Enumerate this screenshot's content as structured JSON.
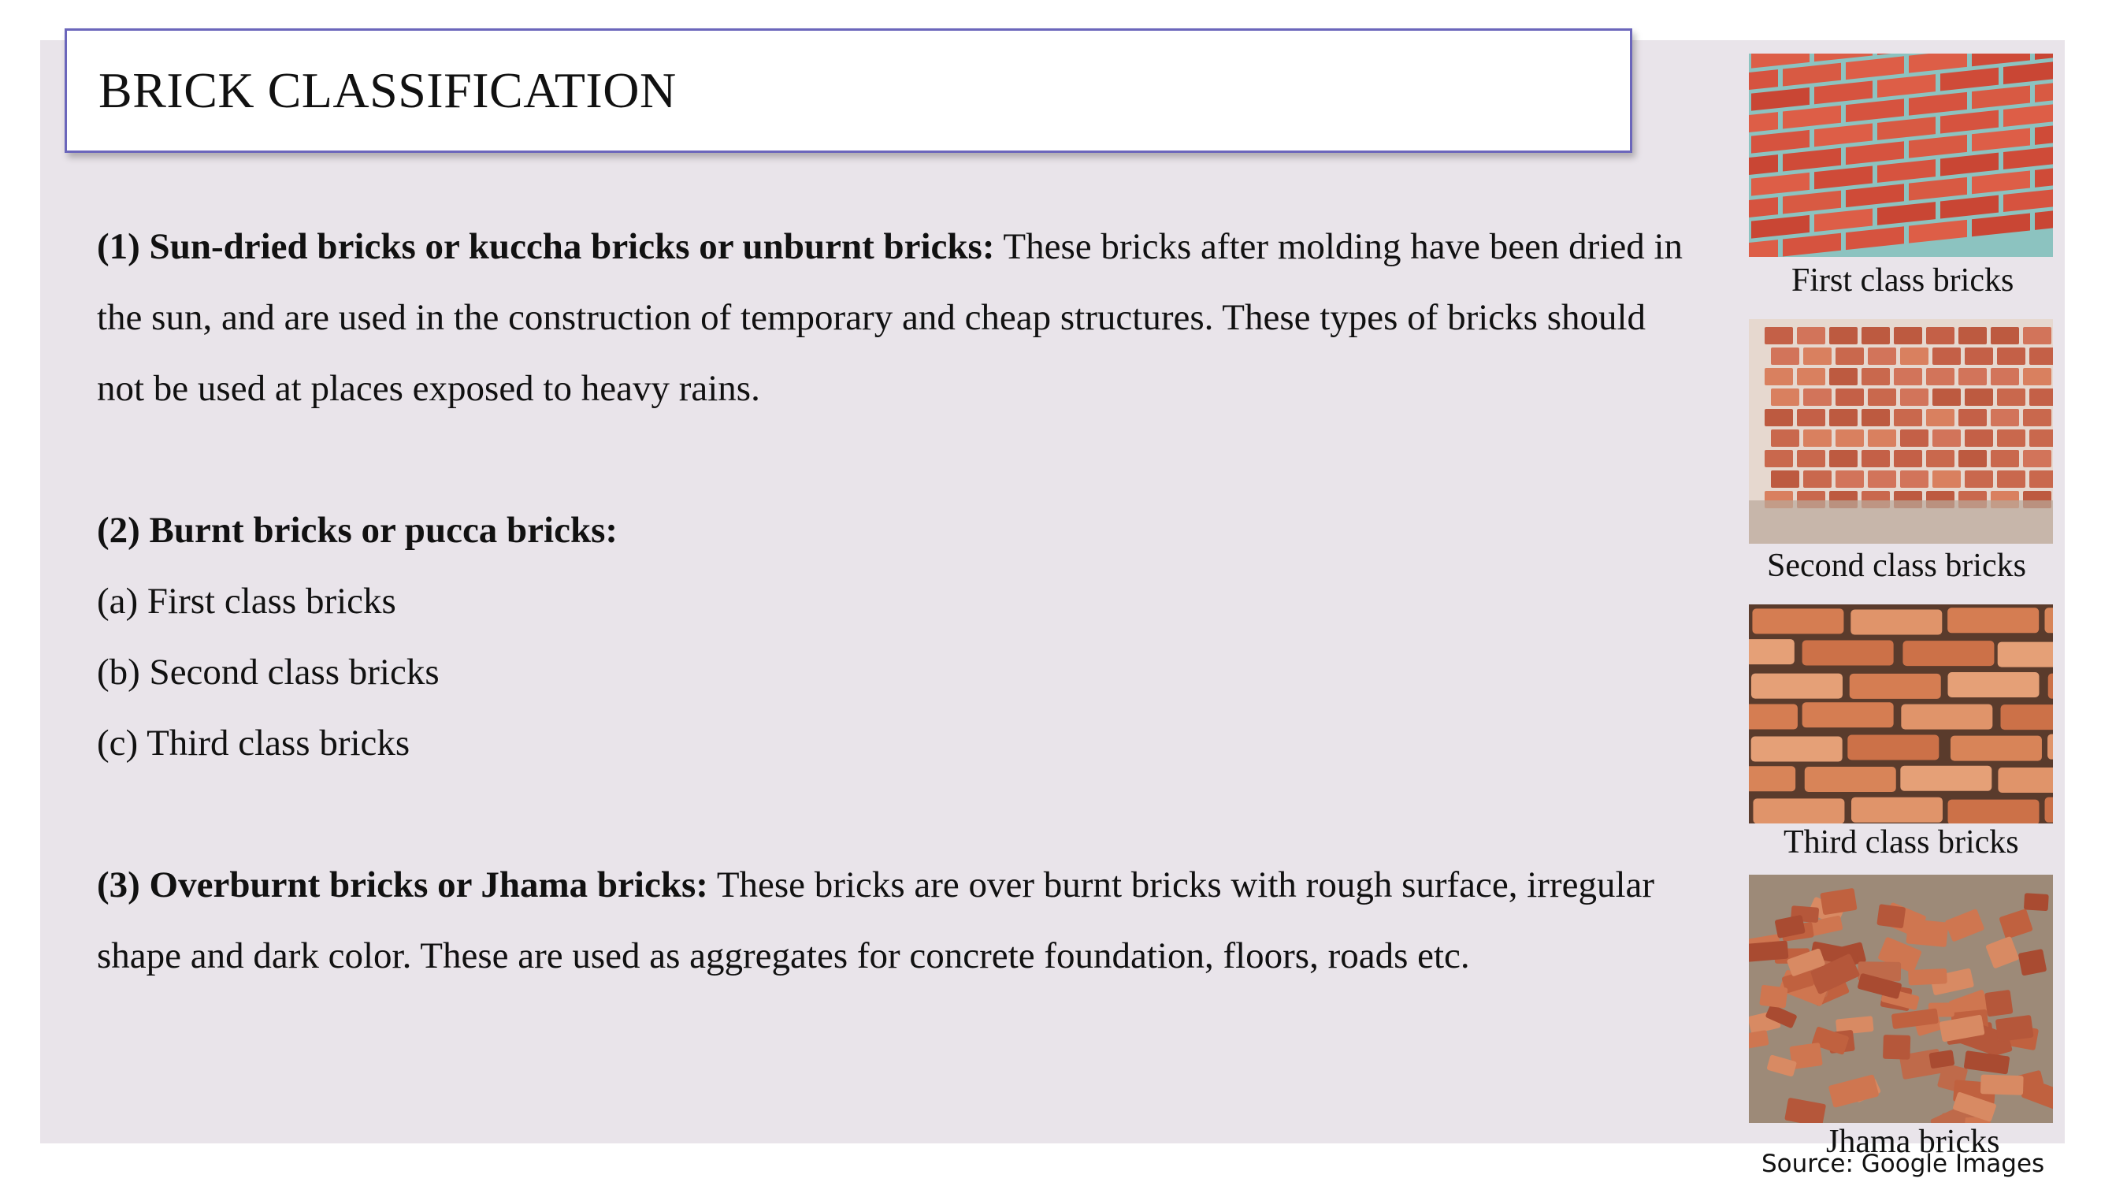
{
  "slide": {
    "title": "BRICK CLASSIFICATION",
    "sections": [
      {
        "heading": "(1) Sun-dried bricks or kuccha bricks or unburnt bricks:",
        "body": " These bricks after molding have been dried in the sun, and are used in the construction of temporary and cheap structures. These types of bricks should not be used at places exposed to heavy rains."
      },
      {
        "heading": "(2) Burnt bricks or pucca bricks:",
        "items": [
          "(a) First class bricks",
          "(b) Second class bricks",
          "(c) Third class bricks"
        ]
      },
      {
        "heading": "(3) Overburnt bricks or Jhama bricks:",
        "body": " These bricks are over burnt bricks with rough surface, irregular shape and dark color. These are used as aggregates for concrete foundation, floors, roads etc."
      }
    ]
  },
  "images": [
    {
      "caption": "First class bricks",
      "icon": "brick-wall-photo"
    },
    {
      "caption": "Second class bricks",
      "icon": "brick-stack-photo"
    },
    {
      "caption": "Third class bricks",
      "icon": "rough-brick-wall-photo"
    },
    {
      "caption": "Jhama bricks",
      "icon": "brick-pile-photo"
    }
  ],
  "source": "Source: Google Images",
  "colors": {
    "slide_background": "#e9e4ea",
    "title_border": "#6b66bb",
    "mortar": "#7fb7b4",
    "brick_red": "#d3533f",
    "brick_orange": "#c8664a"
  }
}
